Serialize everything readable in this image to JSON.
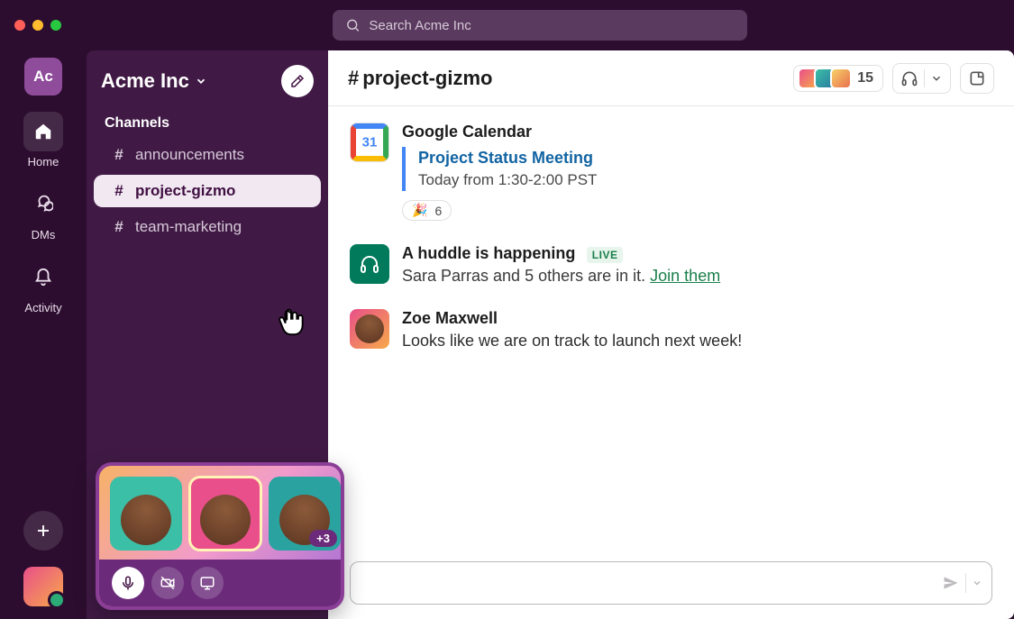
{
  "search": {
    "placeholder": "Search Acme Inc"
  },
  "rail": {
    "workspace_initials": "Ac",
    "items": [
      {
        "label": "Home"
      },
      {
        "label": "DMs"
      },
      {
        "label": "Activity"
      }
    ]
  },
  "sidebar": {
    "workspace_name": "Acme Inc",
    "section_label": "Channels",
    "channels": [
      {
        "name": "announcements"
      },
      {
        "name": "project-gizmo"
      },
      {
        "name": "team-marketing"
      }
    ]
  },
  "huddle_widget": {
    "overflow_badge": "+3"
  },
  "channel_header": {
    "name": "project-gizmo",
    "member_count": "15"
  },
  "messages": {
    "gcal": {
      "app_name": "Google Calendar",
      "event_title": "Project Status Meeting",
      "event_time": "Today from 1:30-2:00 PST",
      "reaction_emoji": "🎉",
      "reaction_count": "6"
    },
    "huddle": {
      "title": "A huddle is happening",
      "live_label": "LIVE",
      "text_prefix": "Sara Parras and 5 others are in it. ",
      "join_label": "Join them "
    },
    "zoe": {
      "name": "Zoe Maxwell",
      "text": "Looks like we are on track to launch next week!"
    }
  }
}
